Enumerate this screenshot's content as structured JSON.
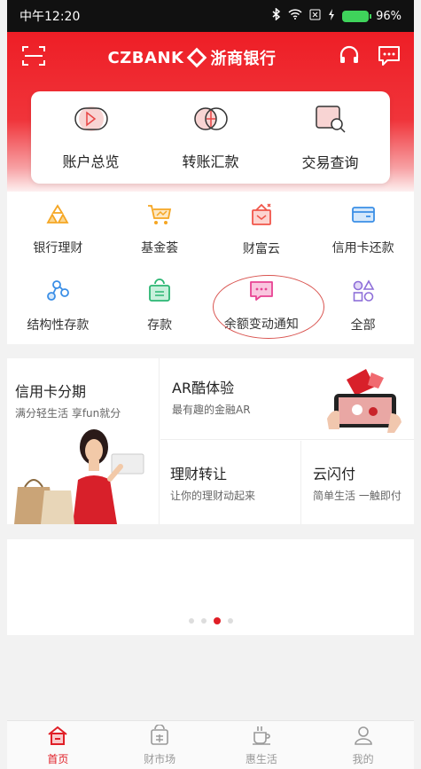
{
  "status_bar": {
    "time": "中午12:20",
    "battery": "96%"
  },
  "header": {
    "brand_text": "CZBANK",
    "brand_cn": "浙商银行"
  },
  "top_card": [
    {
      "label": "账户总览",
      "icon": "account-overview-icon"
    },
    {
      "label": "转账汇款",
      "icon": "transfer-icon"
    },
    {
      "label": "交易查询",
      "icon": "transaction-query-icon"
    }
  ],
  "grid": [
    {
      "label": "银行理财",
      "icon": "bank-wealth-icon",
      "color": "#f5a623"
    },
    {
      "label": "基金荟",
      "icon": "fund-icon",
      "color": "#f5a623"
    },
    {
      "label": "财富云",
      "icon": "wealth-cloud-icon",
      "color": "#f0564a"
    },
    {
      "label": "信用卡还款",
      "icon": "credit-card-icon",
      "color": "#3a8ee6"
    },
    {
      "label": "结构性存款",
      "icon": "structured-deposit-icon",
      "color": "#3a8ee6"
    },
    {
      "label": "存款",
      "icon": "deposit-icon",
      "color": "#2bb673"
    },
    {
      "label": "余额变动通知",
      "icon": "balance-notice-icon",
      "color": "#e84393"
    },
    {
      "label": "全部",
      "icon": "all-icon",
      "color": "#8e6fd9"
    }
  ],
  "promo": {
    "credit": {
      "title": "信用卡分期",
      "subtitle": "满分轻生活 享fun就分"
    },
    "ar": {
      "title": "AR酷体验",
      "subtitle": "最有趣的金融AR"
    },
    "transfer": {
      "title": "理财转让",
      "subtitle": "让你的理财动起来"
    },
    "quickpass": {
      "title": "云闪付",
      "subtitle": "简单生活 一触即付"
    }
  },
  "bottom_nav": [
    {
      "label": "首页",
      "icon": "home-icon",
      "active": true
    },
    {
      "label": "财市场",
      "icon": "market-icon",
      "active": false
    },
    {
      "label": "惠生活",
      "icon": "life-icon",
      "active": false
    },
    {
      "label": "我的",
      "icon": "profile-icon",
      "active": false
    }
  ],
  "colors": {
    "brand_red": "#e01e26"
  }
}
